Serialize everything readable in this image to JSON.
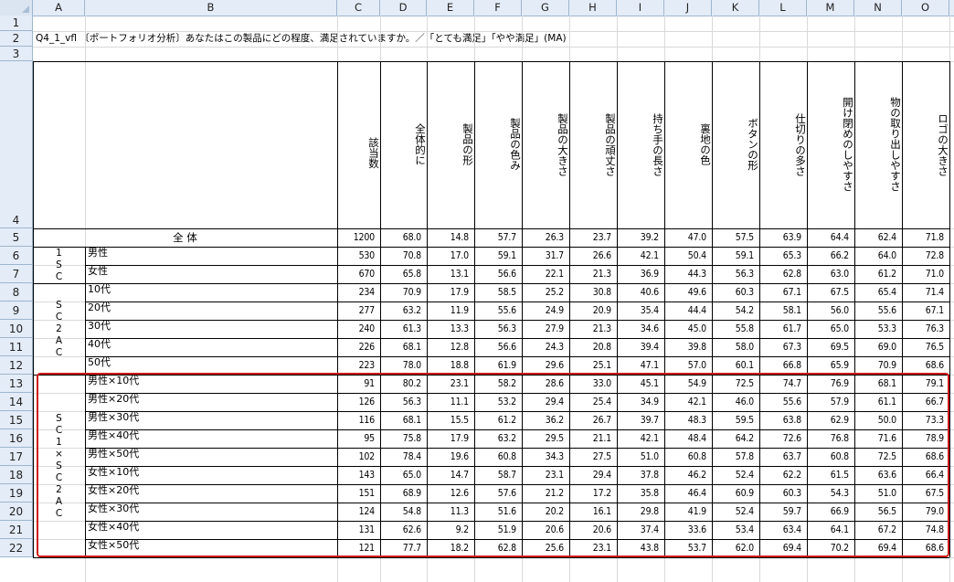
{
  "columns": [
    "A",
    "B",
    "C",
    "D",
    "E",
    "F",
    "G",
    "H",
    "I",
    "J",
    "K",
    "L",
    "M",
    "N",
    "O"
  ],
  "rows": [
    "1",
    "2",
    "3",
    "4",
    "5",
    "6",
    "7",
    "8",
    "9",
    "10",
    "11",
    "12",
    "13",
    "14",
    "15",
    "16",
    "17",
    "18",
    "19",
    "20",
    "21",
    "22"
  ],
  "title": "Q4_1_vfl 〔ポートフォリオ分析〕あなたはこの製品にどの程度、満足されていますか。／「とても満足」「やや満足」(MA)",
  "header_labels": {
    "C": "該当数",
    "D": "全体的に",
    "E": "製品の形",
    "F": "製品の色み",
    "G": "製品の大きさ",
    "H": "製品の頑丈さ",
    "I": "持ち手の長さ",
    "J": "裏地の色",
    "K": "ボタンの形",
    "L": "仕切りの多さ",
    "M": "開け閉めのしやすさ",
    "N": "物の取り出しやすさ",
    "O": "ロゴの大きさ"
  },
  "total_label": "全 体",
  "groups": [
    {
      "label": "1 S C",
      "rows": [
        6,
        7
      ]
    },
    {
      "label": "S C 2 A C",
      "rows": [
        8,
        12
      ]
    },
    {
      "label": "S C 1 × S C 2 A C",
      "rows": [
        13,
        22
      ]
    }
  ],
  "table": [
    {
      "label": "",
      "values": [
        "1200",
        "68.0",
        "14.8",
        "57.7",
        "26.3",
        "23.7",
        "39.2",
        "47.0",
        "57.5",
        "63.9",
        "64.4",
        "62.4",
        "71.8"
      ]
    },
    {
      "label": "男性",
      "values": [
        "530",
        "70.8",
        "17.0",
        "59.1",
        "31.7",
        "26.6",
        "42.1",
        "50.4",
        "59.1",
        "65.3",
        "66.2",
        "64.0",
        "72.8"
      ]
    },
    {
      "label": "女性",
      "values": [
        "670",
        "65.8",
        "13.1",
        "56.6",
        "22.1",
        "21.3",
        "36.9",
        "44.3",
        "56.3",
        "62.8",
        "63.0",
        "61.2",
        "71.0"
      ]
    },
    {
      "label": "10代",
      "values": [
        "234",
        "70.9",
        "17.9",
        "58.5",
        "25.2",
        "30.8",
        "40.6",
        "49.6",
        "60.3",
        "67.1",
        "67.5",
        "65.4",
        "71.4"
      ]
    },
    {
      "label": "20代",
      "values": [
        "277",
        "63.2",
        "11.9",
        "55.6",
        "24.9",
        "20.9",
        "35.4",
        "44.4",
        "54.2",
        "58.1",
        "56.0",
        "55.6",
        "67.1"
      ]
    },
    {
      "label": "30代",
      "values": [
        "240",
        "61.3",
        "13.3",
        "56.3",
        "27.9",
        "21.3",
        "34.6",
        "45.0",
        "55.8",
        "61.7",
        "65.0",
        "53.3",
        "76.3"
      ]
    },
    {
      "label": "40代",
      "values": [
        "226",
        "68.1",
        "12.8",
        "56.6",
        "24.3",
        "20.8",
        "39.4",
        "39.8",
        "58.0",
        "67.3",
        "69.5",
        "69.0",
        "76.5"
      ]
    },
    {
      "label": "50代",
      "values": [
        "223",
        "78.0",
        "18.8",
        "61.9",
        "29.6",
        "25.1",
        "47.1",
        "57.0",
        "60.1",
        "66.8",
        "65.9",
        "70.9",
        "68.6"
      ]
    },
    {
      "label": "男性×10代",
      "values": [
        "91",
        "80.2",
        "23.1",
        "58.2",
        "28.6",
        "33.0",
        "45.1",
        "54.9",
        "72.5",
        "74.7",
        "76.9",
        "68.1",
        "79.1"
      ]
    },
    {
      "label": "男性×20代",
      "values": [
        "126",
        "56.3",
        "11.1",
        "53.2",
        "29.4",
        "25.4",
        "34.9",
        "42.1",
        "46.0",
        "55.6",
        "57.9",
        "61.1",
        "66.7"
      ]
    },
    {
      "label": "男性×30代",
      "values": [
        "116",
        "68.1",
        "15.5",
        "61.2",
        "36.2",
        "26.7",
        "39.7",
        "48.3",
        "59.5",
        "63.8",
        "62.9",
        "50.0",
        "73.3"
      ]
    },
    {
      "label": "男性×40代",
      "values": [
        "95",
        "75.8",
        "17.9",
        "63.2",
        "29.5",
        "21.1",
        "42.1",
        "48.4",
        "64.2",
        "72.6",
        "76.8",
        "71.6",
        "78.9"
      ]
    },
    {
      "label": "男性×50代",
      "values": [
        "102",
        "78.4",
        "19.6",
        "60.8",
        "34.3",
        "27.5",
        "51.0",
        "60.8",
        "57.8",
        "63.7",
        "60.8",
        "72.5",
        "68.6"
      ]
    },
    {
      "label": "女性×10代",
      "values": [
        "143",
        "65.0",
        "14.7",
        "58.7",
        "23.1",
        "29.4",
        "37.8",
        "46.2",
        "52.4",
        "62.2",
        "61.5",
        "63.6",
        "66.4"
      ]
    },
    {
      "label": "女性×20代",
      "values": [
        "151",
        "68.9",
        "12.6",
        "57.6",
        "21.2",
        "17.2",
        "35.8",
        "46.4",
        "60.9",
        "60.3",
        "54.3",
        "51.0",
        "67.5"
      ]
    },
    {
      "label": "女性×30代",
      "values": [
        "124",
        "54.8",
        "11.3",
        "51.6",
        "20.2",
        "16.1",
        "29.8",
        "41.9",
        "52.4",
        "59.7",
        "66.9",
        "56.5",
        "79.0"
      ]
    },
    {
      "label": "女性×40代",
      "values": [
        "131",
        "62.6",
        "9.2",
        "51.9",
        "20.6",
        "20.6",
        "37.4",
        "33.6",
        "53.4",
        "63.4",
        "64.1",
        "67.2",
        "74.8"
      ]
    },
    {
      "label": "女性×50代",
      "values": [
        "121",
        "77.7",
        "18.2",
        "62.8",
        "25.6",
        "23.1",
        "43.8",
        "53.7",
        "62.0",
        "69.4",
        "70.2",
        "69.4",
        "68.6"
      ]
    }
  ],
  "highlight": {
    "color": "#d01818",
    "rows": [
      13,
      22
    ]
  }
}
